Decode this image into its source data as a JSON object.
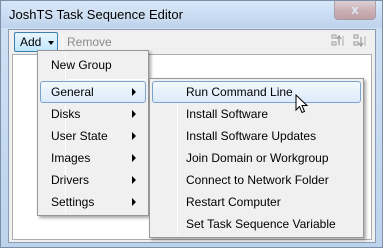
{
  "window": {
    "title": "JoshTS Task Sequence Editor",
    "close_glyph": "x"
  },
  "toolbar": {
    "add_label": "Add",
    "remove_label": "Remove",
    "icons": [
      "move-up-icon",
      "move-down-icon"
    ]
  },
  "add_menu": {
    "items": [
      {
        "label": "New Group",
        "has_submenu": false
      },
      {
        "label": "General",
        "has_submenu": true,
        "selected": true
      },
      {
        "label": "Disks",
        "has_submenu": true
      },
      {
        "label": "User State",
        "has_submenu": true
      },
      {
        "label": "Images",
        "has_submenu": true
      },
      {
        "label": "Drivers",
        "has_submenu": true
      },
      {
        "label": "Settings",
        "has_submenu": true
      }
    ]
  },
  "general_submenu": {
    "items": [
      {
        "label": "Run Command Line",
        "selected": true
      },
      {
        "label": "Install Software"
      },
      {
        "label": "Install Software Updates"
      },
      {
        "label": "Join Domain or Workgroup"
      },
      {
        "label": "Connect to Network Folder"
      },
      {
        "label": "Restart Computer"
      },
      {
        "label": "Set Task Sequence Variable"
      }
    ]
  },
  "colors": {
    "selection_border": "#7da2ce",
    "add_button_border": "#3c7fb1",
    "menu_background": "#f0f0f0"
  }
}
